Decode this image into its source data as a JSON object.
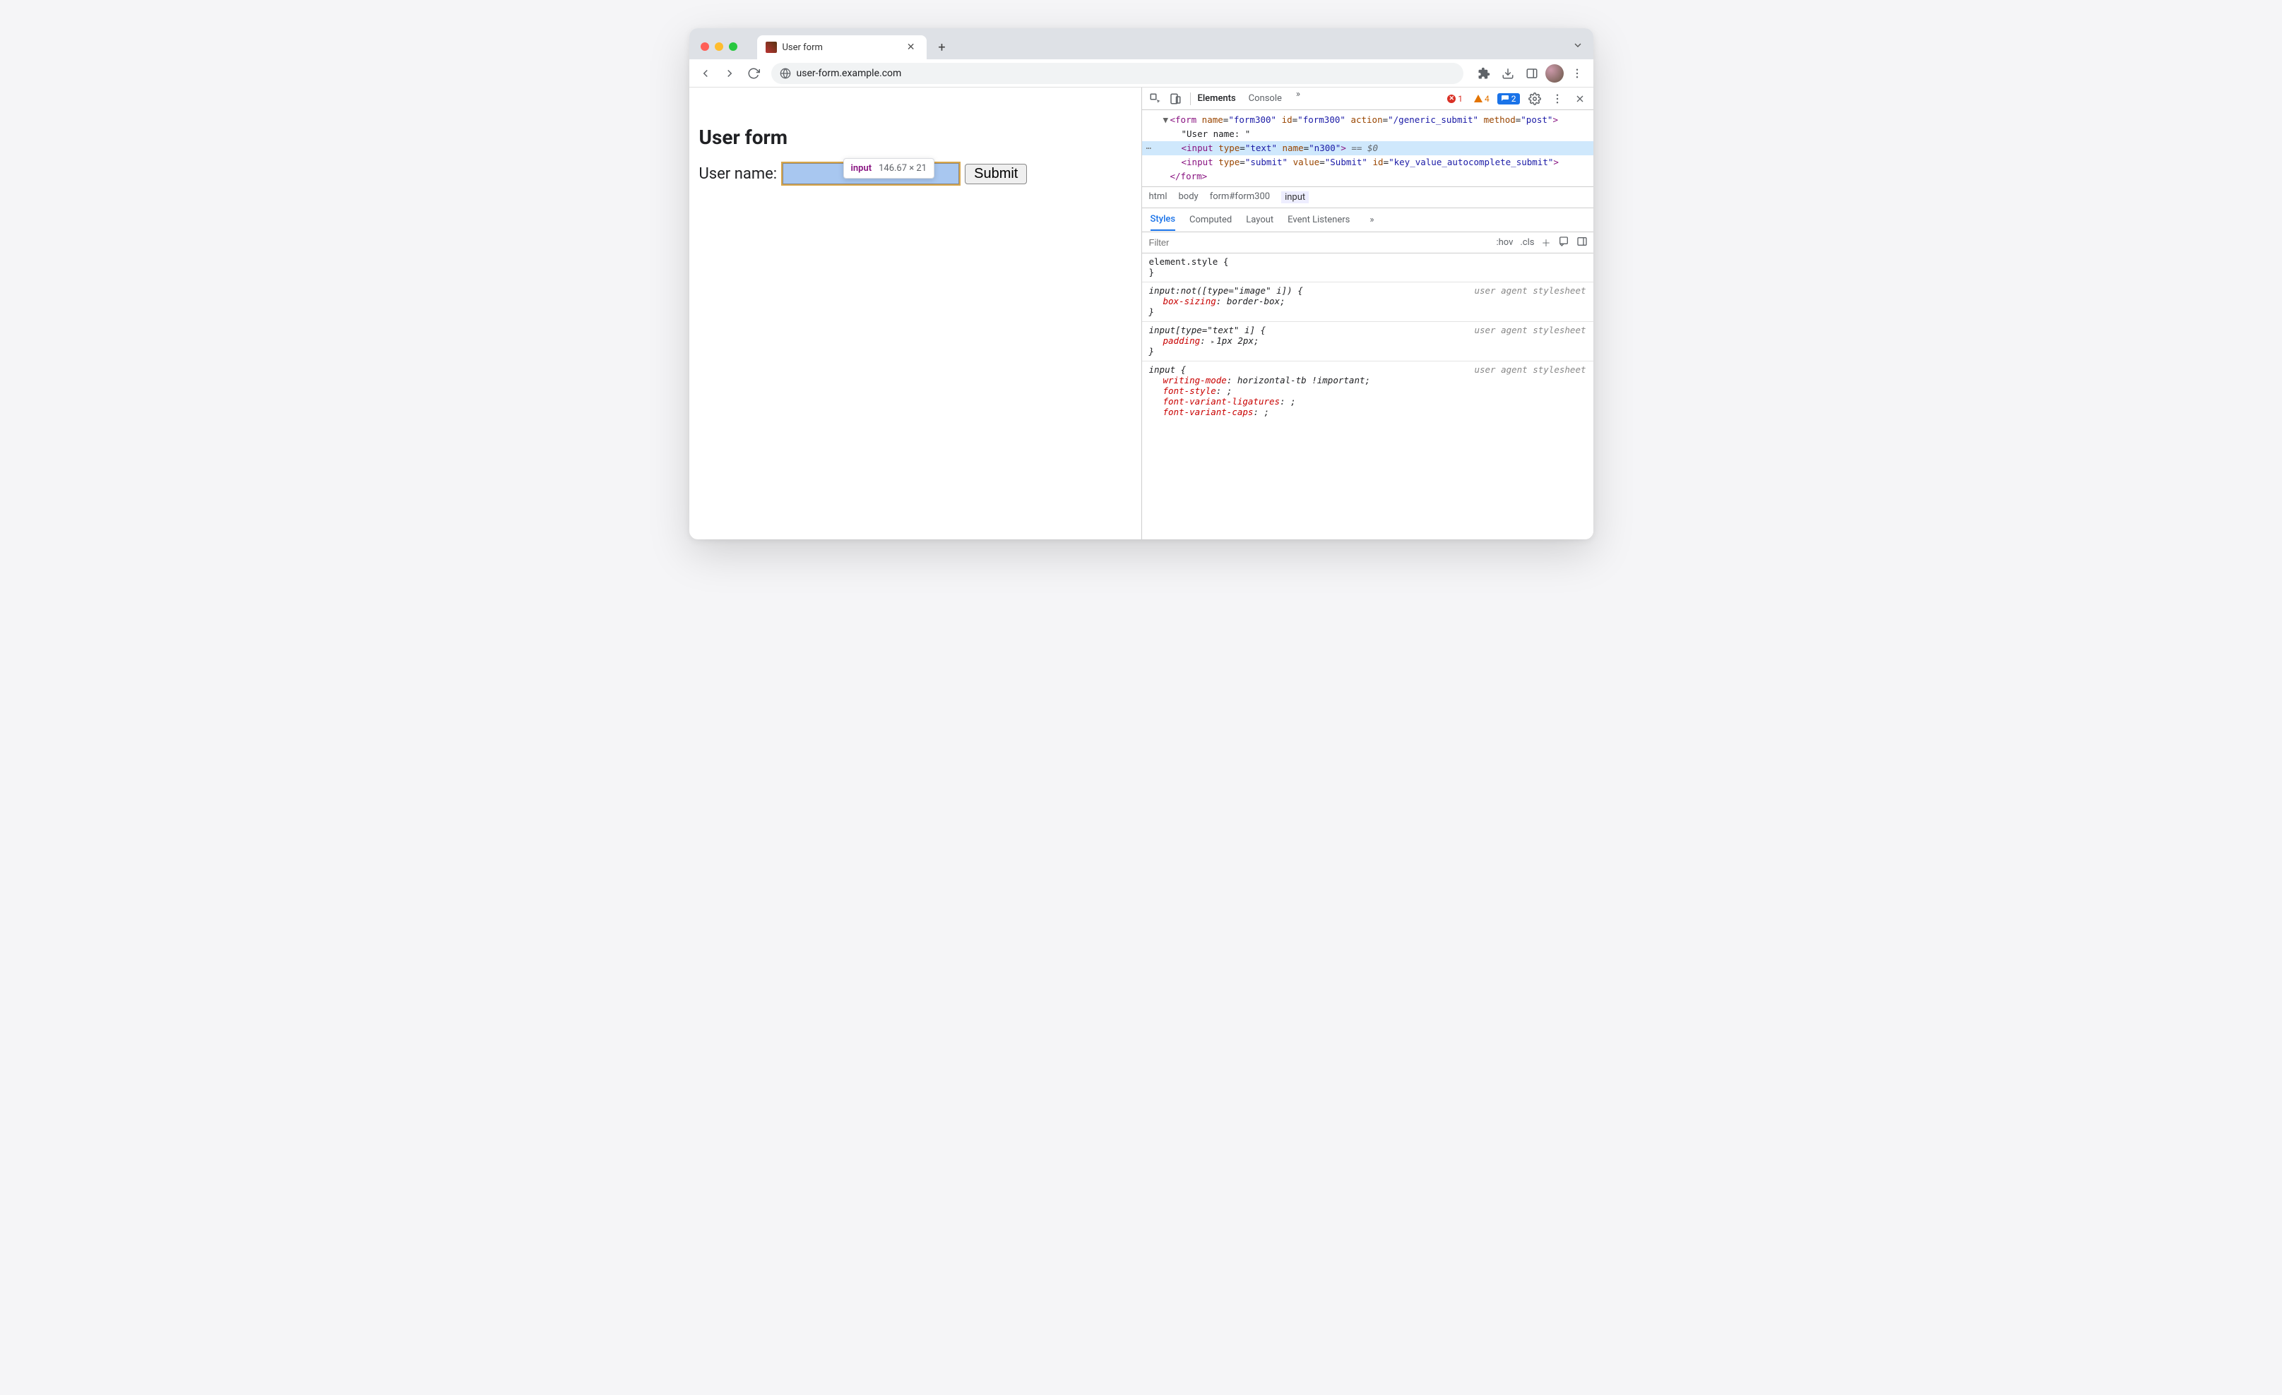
{
  "browser": {
    "tab_title": "User form",
    "url": "user-form.example.com"
  },
  "page": {
    "heading": "User form",
    "label": "User name:",
    "submit": "Submit",
    "tooltip_tag": "input",
    "tooltip_dims": "146.67 × 21"
  },
  "devtools": {
    "tabs": {
      "elements": "Elements",
      "console": "Console"
    },
    "errors": "1",
    "warnings": "4",
    "messages": "2",
    "dom": {
      "form_open": "<form name=\"form300\" id=\"form300\" action=\"/generic_submit\" method=\"post\">",
      "text_node": "\"User name: \"",
      "input_text": "<input type=\"text\" name=\"n300\">",
      "eq_dollar": " == $0",
      "input_submit": "<input type=\"submit\" value=\"Submit\" id=\"key_value_autocomplete_submit\">",
      "form_close": "</form>"
    },
    "crumbs": [
      "html",
      "body",
      "form#form300",
      "input"
    ],
    "styles_tabs": {
      "styles": "Styles",
      "computed": "Computed",
      "layout": "Layout",
      "listeners": "Event Listeners"
    },
    "filter_placeholder": "Filter",
    "hov": ":hov",
    "cls": ".cls",
    "rules": {
      "element_style_sel": "element.style {",
      "close": "}",
      "ua_label": "user agent stylesheet",
      "r1_sel": "input:not([type=\"image\" i]) {",
      "r1_p": "box-sizing",
      "r1_v": "border-box",
      "r2_sel": "input[type=\"text\" i] {",
      "r2_p": "padding",
      "r2_v": "1px 2px",
      "r3_sel": "input {",
      "r3_p1": "writing-mode",
      "r3_v1": "horizontal-tb !important",
      "r3_p2": "font-style",
      "r3_v2": "",
      "r3_p3": "font-variant-ligatures",
      "r3_v3": "",
      "r3_p4": "font-variant-caps",
      "r3_v4": ""
    }
  }
}
